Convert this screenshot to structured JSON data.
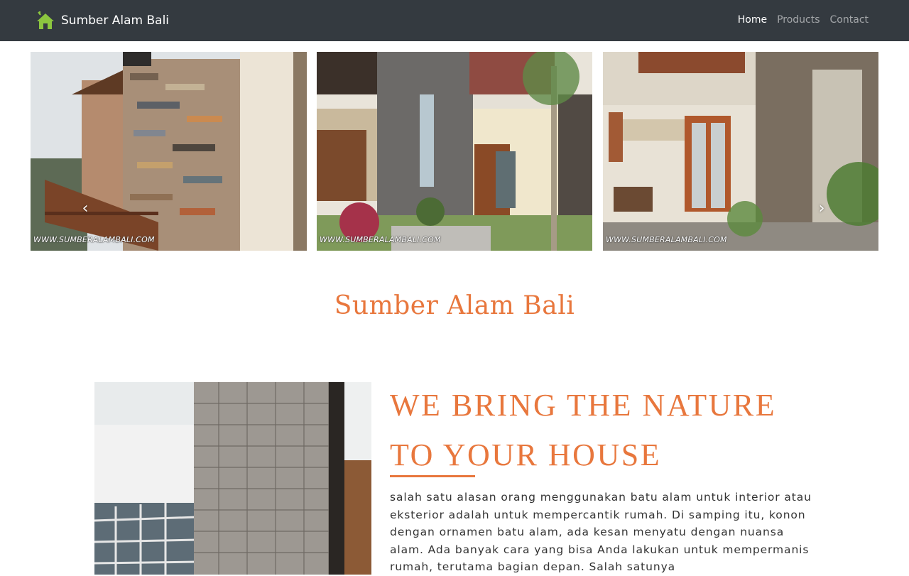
{
  "navbar": {
    "brand": "Sumber Alam Bali",
    "logo_icon": "house-icon",
    "background": "#343a40",
    "links": [
      {
        "label": "Home",
        "active": true
      },
      {
        "label": "Products",
        "active": false
      },
      {
        "label": "Contact",
        "active": false
      }
    ]
  },
  "carousel": {
    "slides": [
      {
        "watermark": "WWW.SUMBERALAMBALI.COM",
        "image": "house-wall-multicolor-stone-photo"
      },
      {
        "watermark": "WWW.SUMBERALAMBALI.COM",
        "image": "house-entrance-grey-stone-photo"
      },
      {
        "watermark": "WWW.SUMBERALAMBALI.COM",
        "image": "house-front-carved-stone-photo"
      }
    ],
    "prev_icon": "chevron-left-icon",
    "next_icon": "chevron-right-icon"
  },
  "main": {
    "title": "Sumber Alam Bali",
    "about": {
      "heading_line1": "WE BRING THE NATURE",
      "heading_line2": "TO YOUR HOUSE",
      "text": "salah satu alasan orang menggunakan batu alam untuk interior atau eksterior adalah untuk mempercantik rumah. Di samping itu, konon dengan ornamen batu alam, ada kesan menyatu dengan nuansa alam. Ada banyak cara yang bisa Anda lakukan untuk mempermanis rumah, terutama bagian depan. Salah satunya",
      "image": "stone-wall-building-photo"
    }
  },
  "colors": {
    "accent": "#e8773d",
    "logo_green": "#8cc63f",
    "nav_text_muted": "rgba(255,255,255,0.55)"
  }
}
